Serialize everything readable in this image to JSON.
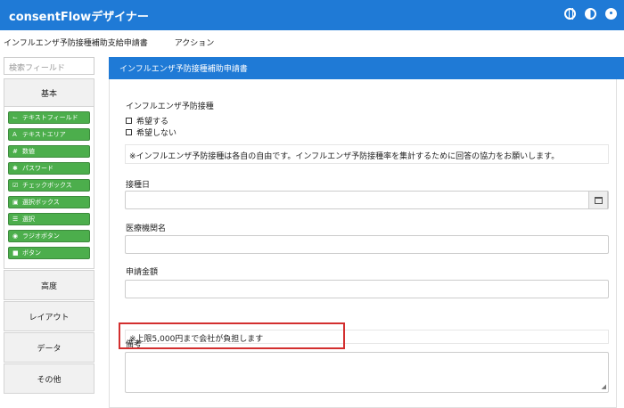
{
  "app": {
    "title": "consentFlowデザイナー"
  },
  "header_icons": [
    "globe-icon",
    "contrast-icon",
    "user-icon"
  ],
  "subnav": {
    "doc_title": "インフルエンザ予防接種補助支給申請書",
    "actions": "アクション"
  },
  "sidebar": {
    "search_placeholder": "検索フィールド",
    "basic_label": "基本",
    "items": [
      {
        "icon": "⌙",
        "label": "テキストフィールド"
      },
      {
        "icon": "A",
        "label": "テキストエリア"
      },
      {
        "icon": "#",
        "label": "数値"
      },
      {
        "icon": "✱",
        "label": "パスワード"
      },
      {
        "icon": "☑",
        "label": "チェックボックス"
      },
      {
        "icon": "▣",
        "label": "選択ボックス"
      },
      {
        "icon": "☰",
        "label": "選択"
      },
      {
        "icon": "◉",
        "label": "ラジオボタン"
      },
      {
        "icon": "■",
        "label": "ボタン"
      }
    ],
    "groups": [
      "高度",
      "レイアウト",
      "データ",
      "その他"
    ]
  },
  "form": {
    "title": "インフルエンザ予防接種補助申請書",
    "vaccination_label": "インフルエンザ予防接種",
    "options": [
      "希望する",
      "希望しない"
    ],
    "note1": "※インフルエンザ予防接種は各自の自由です。インフルエンザ予防接種率を集計するために回答の協力をお願いします。",
    "date_label": "接種日",
    "clinic_label": "医療機関名",
    "amount_label": "申請金額",
    "note2": "※上限5,000円まで会社が負担します",
    "remarks_label": "備考"
  },
  "colors": {
    "primary": "#1f7ad6",
    "component_green": "#4cae4c",
    "highlight": "#d32f2f"
  }
}
